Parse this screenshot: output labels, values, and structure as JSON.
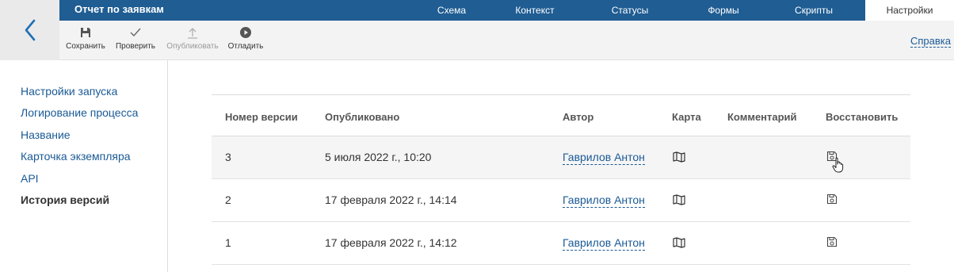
{
  "app": {
    "title": "Отчет по заявкам",
    "accent": "#1f5d93"
  },
  "tabs": [
    {
      "label": "Схема",
      "active": false
    },
    {
      "label": "Контекст",
      "active": false
    },
    {
      "label": "Статусы",
      "active": false
    },
    {
      "label": "Формы",
      "active": false
    },
    {
      "label": "Скрипты",
      "active": false
    },
    {
      "label": "Настройки",
      "active": true
    }
  ],
  "toolbar": {
    "save_label": "Сохранить",
    "check_label": "Проверить",
    "publish_label": "Опубликовать",
    "debug_label": "Отладить",
    "help_label": "Справка"
  },
  "sidebar": {
    "items": [
      {
        "label": "Настройки запуска"
      },
      {
        "label": "Логирование процесса"
      },
      {
        "label": "Название"
      },
      {
        "label": "Карточка экземпляра"
      },
      {
        "label": "API"
      },
      {
        "label": "История версий",
        "active": true
      }
    ]
  },
  "table": {
    "columns": [
      "Номер версии",
      "Опубликовано",
      "Автор",
      "Карта",
      "Комментарий",
      "Восстановить"
    ],
    "rows": [
      {
        "version": "3",
        "published": "5 июля 2022 г., 10:20",
        "author": "Гаврилов Антон",
        "comment": ""
      },
      {
        "version": "2",
        "published": "17 февраля 2022 г., 14:14",
        "author": "Гаврилов Антон",
        "comment": ""
      },
      {
        "version": "1",
        "published": "17 февраля 2022 г., 14:12",
        "author": "Гаврилов Антон",
        "comment": ""
      }
    ]
  }
}
